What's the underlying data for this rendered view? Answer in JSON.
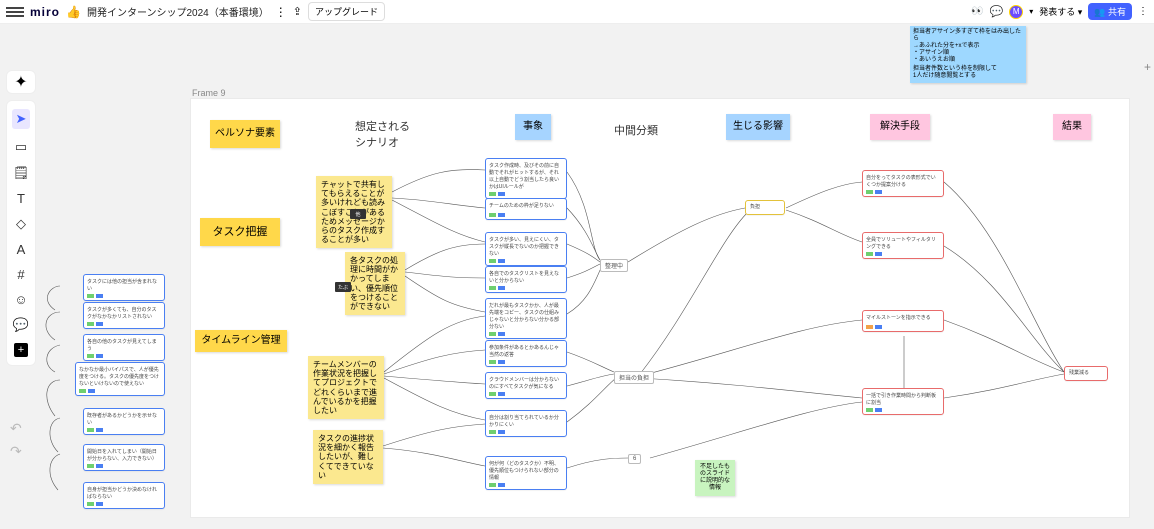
{
  "topbar": {
    "logo": "miro",
    "thumbs": "👍",
    "title": "開発インターンシップ2024（本番環境）",
    "upgrade": "アップグレード",
    "present": "発表する",
    "share": "共有",
    "avatar_initial": "M"
  },
  "note_top": {
    "line1": "担当者アサイン多すぎて枠をはみ出したら",
    "line2": "→あふれた分を+xで表示",
    "line3": "・アサイン順",
    "line4": "・あいうえお順",
    "line5": "担当者件数という枠を制限して",
    "line6": "1人だけ随意閲覧とする"
  },
  "frame_label": "Frame 9",
  "columns": {
    "c1": "ペルソナ要素",
    "c2": "想定される\nシナリオ",
    "c3": "事象",
    "c4": "中間分類",
    "c5": "生じる影響",
    "c6": "解決手段",
    "c7": "結果"
  },
  "persona_big": {
    "p1": "タスク把握",
    "p2": "タイムライン管理"
  },
  "scenario_notes": {
    "s1": "チャットで共有してもらえることが多いけれども読みこぼすことがあるためメッセージからのタスク作成することが多い",
    "s2": "各タスクの処理に時間がかかってしまい、優先順位をつけることができない",
    "s3": "チームメンバーの作業状況を把握してプロジェクトでどれくらいまで進んでいるかを把握したい",
    "s4": "タスクの進捗状況を細かく報告したいが、難しくてできていない"
  },
  "dark_chips": {
    "d1": "他",
    "d2": "たぶ"
  },
  "left_cards": {
    "l1": "タスクには他の担当が含まれない",
    "l2": "タスクが多くても、自分のタスクがなかなかリストされない",
    "l3": "各自の他のタスクが見えてしまう",
    "l4": "なかなか最小バイパスで、人が優先度をつける。タスクの優先度をつけないといけないので使えない",
    "l5": "既存者があるかどうかを示せない",
    "l6": "開始日を入れてしまい（開始日が分からない、入力できない）",
    "l7": "自身が担当かどうか決めなければならない"
  },
  "event_cards": {
    "e1": "タスク作成時、及びその前に自動でそれがヒットするが、それ以上自動でどう割当したら良いかはUIルールが",
    "e2": "チームのための枠が足りない",
    "e3": "タスクが多い、見えにくい、タスクが縦長でないのか把握できない",
    "e4": "各自でのタスクリストを見えないと分からない",
    "e5": "だれが最もタスクかか、人が最先端をコピー、タスクの仕組みじゃないと分からない分かる部分ない",
    "e6": "参加条件があるとかあるんじゃ当然の返答",
    "e7": "クラウドメンバーは分からないのにすべてタスクが気になる",
    "e8": "自分は割り当てられているか分かりにくい",
    "e9": "何が何（どのタスクか）不明、優先順位もつけられない部分の情報"
  },
  "mid_tags": {
    "m1": "整理中",
    "m2": "担当の負担"
  },
  "impact": {
    "i1": "負担"
  },
  "green_note": "不足したものスライドに説明的な情報",
  "solutions": {
    "r1": "自分をってタスクの表形式でいくつか提案分ける",
    "r2": "全員でソリュートやフィルタリングできる",
    "r3": "マイルストーンを指示できる",
    "r4": "一括で引き作業時間から判断板に割当"
  },
  "result": "残業減る",
  "rail_tooltips": {
    "cursor": "選択",
    "frame": "フレーム",
    "sticky": "付箋",
    "text": "テキスト",
    "shapes": "図形",
    "pen": "ペン",
    "grid": "グリッド",
    "emoji": "絵文字",
    "comment": "コメント",
    "more": "その他"
  }
}
